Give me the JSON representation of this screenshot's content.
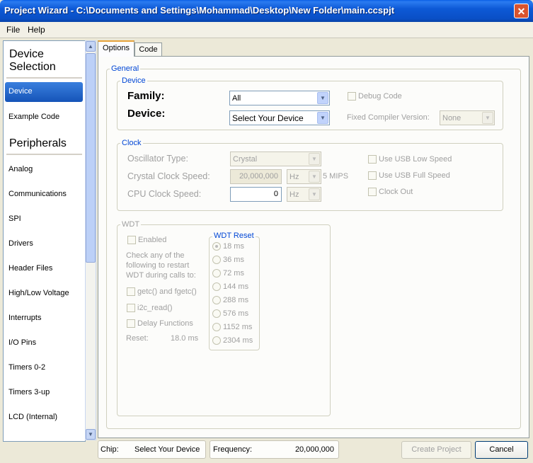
{
  "window": {
    "title": "Project Wizard - C:\\Documents and Settings\\Mohammad\\Desktop\\New Folder\\main.ccspjt",
    "close_glyph": "✕"
  },
  "menu": {
    "file": "File",
    "help": "Help"
  },
  "sidebar": {
    "device_selection_line1": "Device",
    "device_selection_line2": "Selection",
    "items_top": [
      "Device",
      "Example Code"
    ],
    "peripherals_heading": "Peripherals",
    "items": [
      "Analog",
      "Communications",
      "SPI",
      "Drivers",
      "Header Files",
      "High/Low Voltage",
      "Interrupts",
      "I/O Pins",
      "Timers 0-2",
      "Timers 3-up",
      "LCD (Internal)"
    ],
    "selected": "Device"
  },
  "tabs": {
    "options": "Options",
    "code": "Code",
    "active": "Options"
  },
  "general": {
    "label": "General",
    "device_group": {
      "label": "Device",
      "family_label": "Family:",
      "family_value": "All",
      "device_label": "Device:",
      "device_value": "Select Your Device",
      "debug_code_label": "Debug Code",
      "fixed_compiler_label": "Fixed Compiler Version:",
      "fixed_compiler_value": "None"
    },
    "clock_group": {
      "label": "Clock",
      "oscillator_label": "Oscillator Type:",
      "oscillator_value": "Crystal",
      "crystal_speed_label": "Crystal Clock Speed:",
      "crystal_speed_value": "20,000,000",
      "crystal_unit": "Hz",
      "mips": "5 MIPS",
      "cpu_speed_label": "CPU Clock Speed:",
      "cpu_speed_value": "0",
      "cpu_unit": "Hz",
      "usb_low": "Use USB Low Speed",
      "usb_full": "Use USB Full Speed",
      "clock_out": "Clock Out"
    },
    "wdt_group": {
      "label": "WDT",
      "enabled": "Enabled",
      "desc_line1": "Check any of the",
      "desc_line2": "following to restart",
      "desc_line3": "WDT during calls to:",
      "getc": "getc() and fgetc()",
      "i2c": "i2c_read()",
      "delay": "Delay Functions",
      "reset_label": "Reset:",
      "reset_value": "18.0 ms",
      "wdt_reset_label": "WDT Reset",
      "reset_options": [
        "18 ms",
        "36 ms",
        "72 ms",
        "144 ms",
        "288 ms",
        "576 ms",
        "1152 ms",
        "2304 ms"
      ],
      "reset_selected": "18 ms"
    }
  },
  "status": {
    "chip_label": "Chip:",
    "chip_value": "Select Your Device",
    "frequency_label": "Frequency:",
    "frequency_value": "20,000,000",
    "create_project": "Create Project",
    "cancel": "Cancel"
  }
}
